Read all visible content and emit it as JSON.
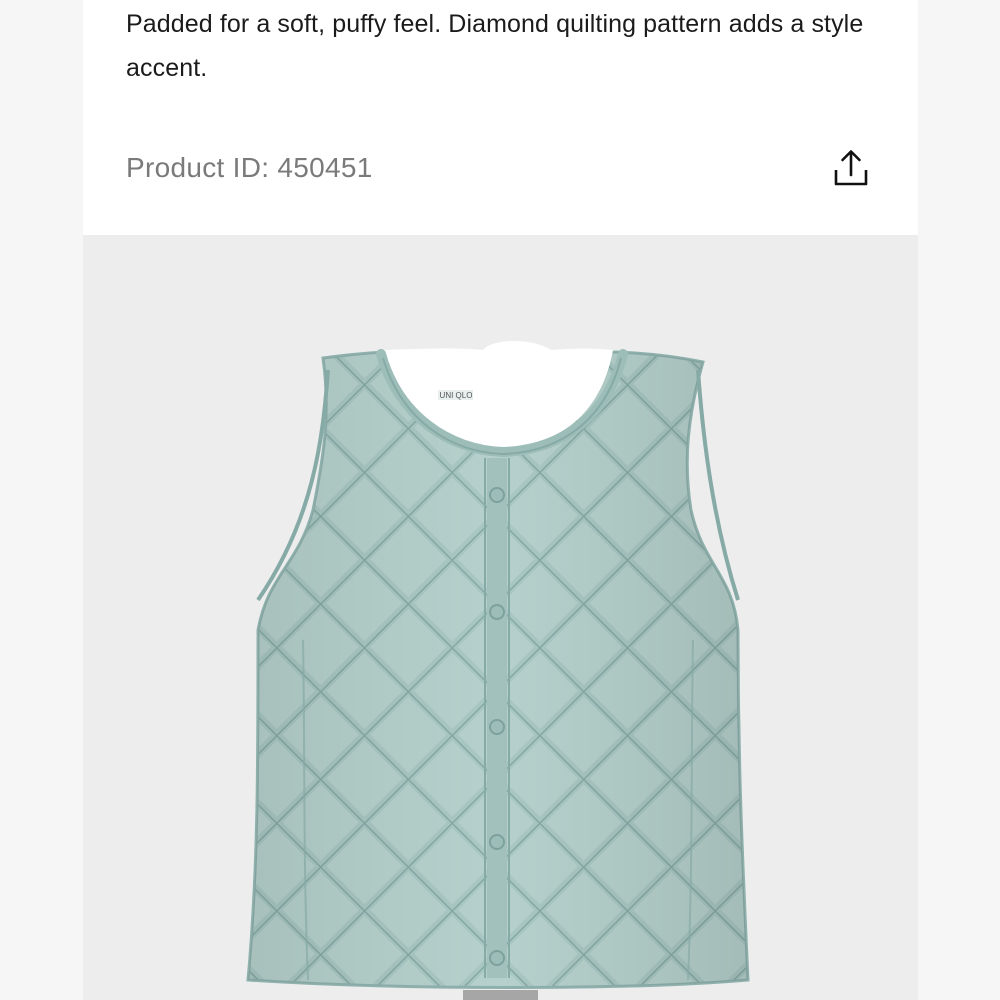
{
  "product": {
    "description": "Padded for a soft, puffy feel. Diamond quilting pattern adds a style accent.",
    "product_id_label": "Product ID: 450451"
  },
  "share": {
    "icon": "share-upload-icon"
  },
  "media": {
    "image_alt": "Quilted light green padded vest",
    "vest_color": "#a9c7c3",
    "vest_shadow_color": "#86aaa6",
    "logo_text": "UNI QLO"
  },
  "colors": {
    "page_background": "#f6f6f6",
    "card_background": "#ffffff",
    "media_background": "#ededed",
    "text_primary": "#1b1b1b",
    "text_secondary": "#7a7a7a",
    "indicator": "#a6a6a6"
  }
}
